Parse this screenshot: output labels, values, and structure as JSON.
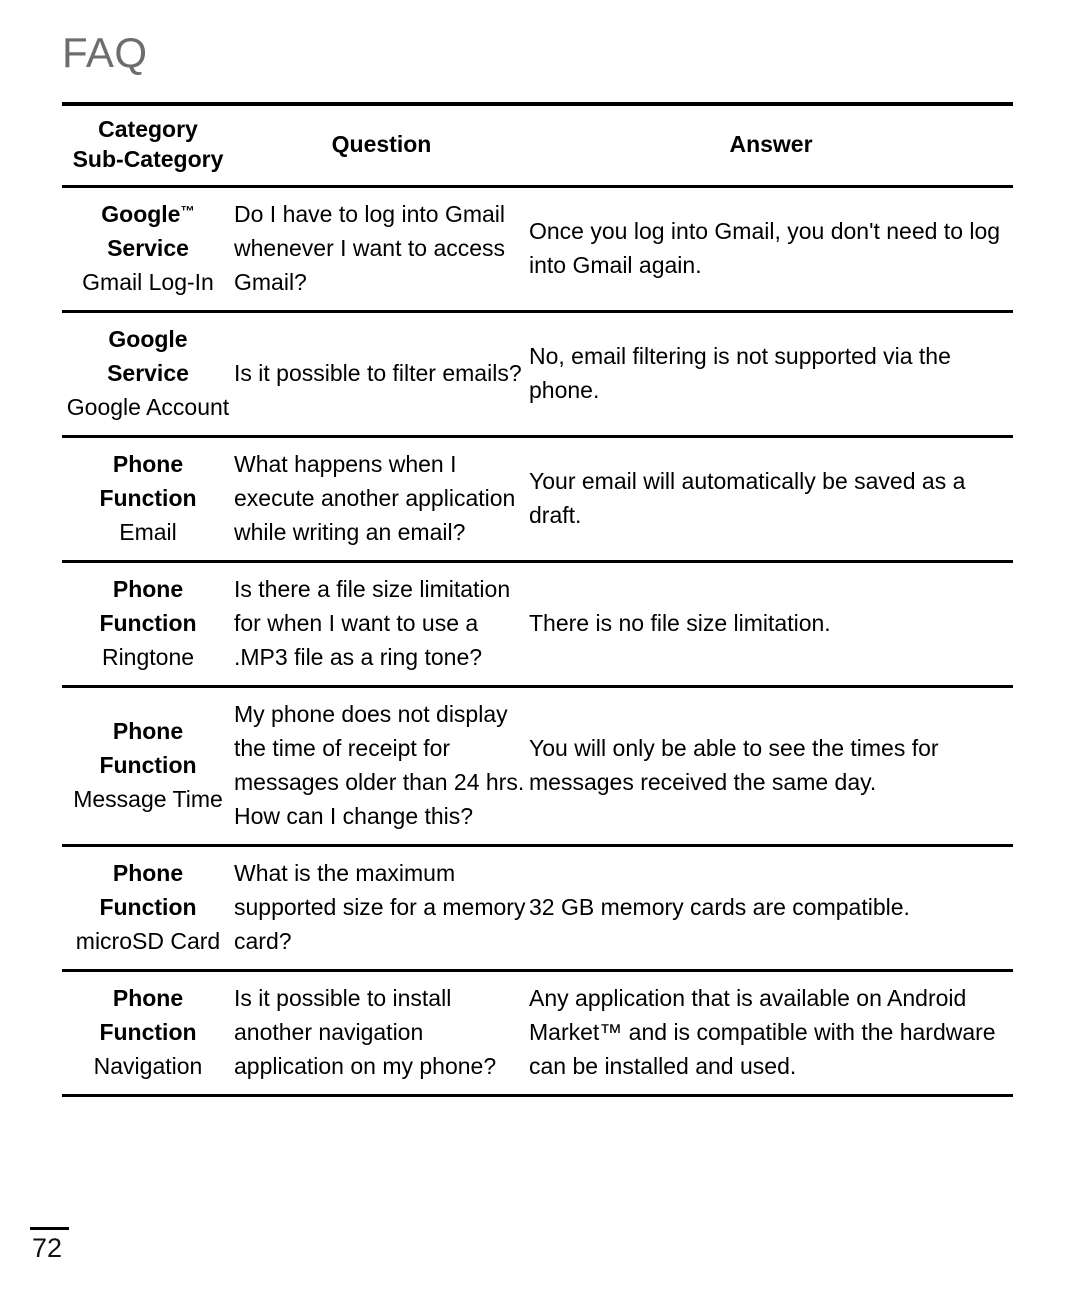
{
  "document": {
    "title": "FAQ",
    "page_number": "72"
  },
  "table": {
    "headers": {
      "category_line1": "Category",
      "category_line2": "Sub-Category",
      "question": "Question",
      "answer": "Answer"
    },
    "rows": [
      {
        "category_main": "Google",
        "category_main_tm": "™",
        "category_main_line2": "Service",
        "category_sub": "Gmail Log-In",
        "question": "Do I have to log into Gmail whenever I want to access Gmail?",
        "answer": "Once you log into Gmail, you don't need to log into Gmail again."
      },
      {
        "category_main": "Google",
        "category_main_tm": "",
        "category_main_line2": "Service",
        "category_sub": "Google Account",
        "question": "Is it possible to filter emails?",
        "answer": "No, email filtering is not supported via the phone."
      },
      {
        "category_main": "Phone",
        "category_main_tm": "",
        "category_main_line2": "Function",
        "category_sub": "Email",
        "question": "What happens when I execute another application while writing an email?",
        "answer": "Your email will automatically be saved as a draft."
      },
      {
        "category_main": "Phone",
        "category_main_tm": "",
        "category_main_line2": "Function",
        "category_sub": "Ringtone",
        "question": "Is there a file size limitation for when I want to use a .MP3 file as a ring tone?",
        "answer": "There is no file size limitation."
      },
      {
        "category_main": "Phone",
        "category_main_tm": "",
        "category_main_line2": "Function",
        "category_sub": "Message Time",
        "question": "My phone does not display the time of receipt for messages older than 24 hrs. How can I change this?",
        "answer": "You will only be able to see the times for messages received the same day."
      },
      {
        "category_main": "Phone",
        "category_main_tm": "",
        "category_main_line2": "Function",
        "category_sub": "microSD Card",
        "question": "What is the maximum supported size for a memory card?",
        "answer": "32 GB memory cards are compatible."
      },
      {
        "category_main": "Phone",
        "category_main_tm": "",
        "category_main_line2": "Function",
        "category_sub": "Navigation",
        "question": "Is it possible to install another navigation application on my phone?",
        "answer": "Any application that is available on Android Market™ and is compatible with the hardware can be installed and used."
      }
    ]
  },
  "colors": {
    "title": "#6d6d6d",
    "text": "#000000",
    "rule": "#000000",
    "background": "#ffffff"
  }
}
